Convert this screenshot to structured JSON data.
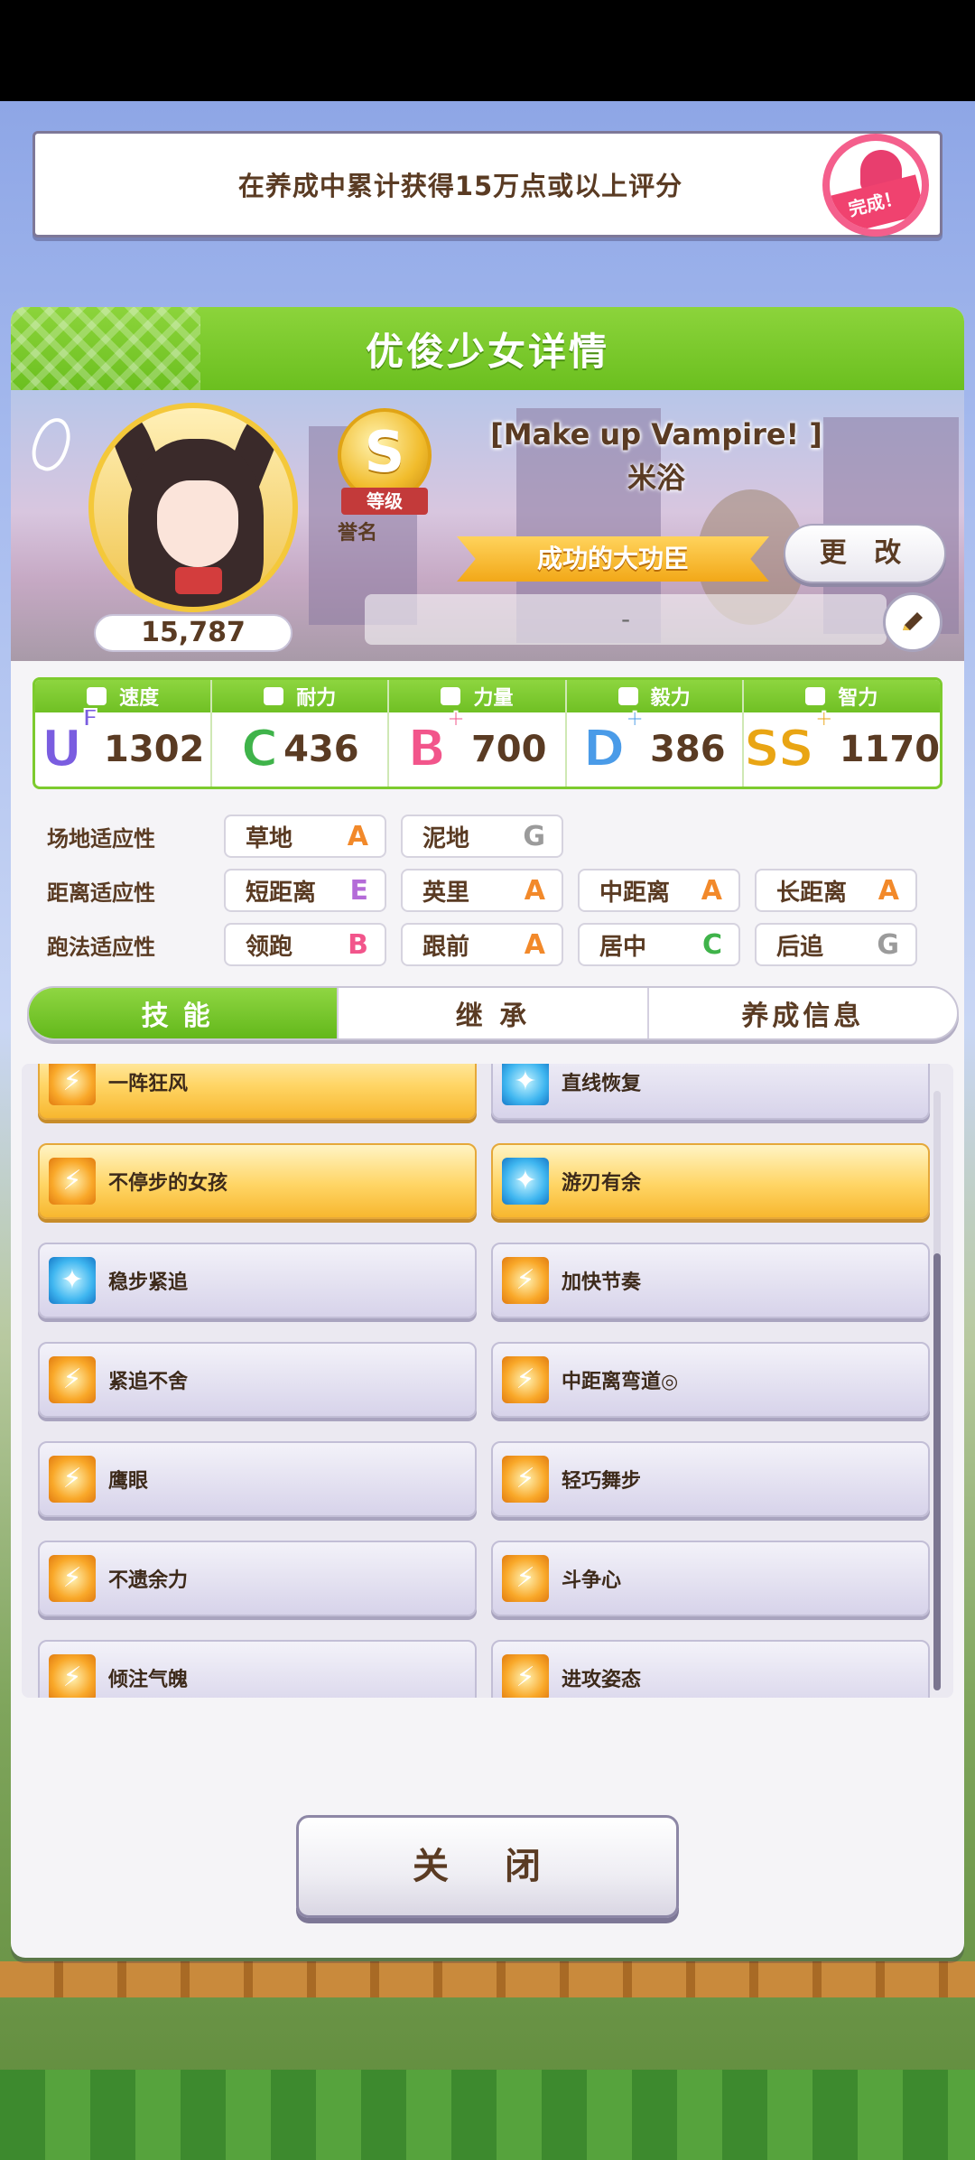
{
  "mission": {
    "text": "在养成中累计获得15万点或以上评分",
    "stamp_label": "完成！"
  },
  "dialog": {
    "title": "优俊少女详情"
  },
  "profile": {
    "score": "15,787",
    "rank_letter": "S",
    "rank_label": "等级",
    "title_label": "誉名",
    "outfit": "[Make up Vampire! ]",
    "name": "米浴",
    "epithet": "成功的大功臣",
    "change_label": "更 改",
    "memo": "-"
  },
  "stats": [
    {
      "label": "速度",
      "grade": "U",
      "grade_sup": "F",
      "value": "1302",
      "color": "#7a5de0"
    },
    {
      "label": "耐力",
      "grade": "C",
      "grade_sup": "",
      "value": "436",
      "color": "#3fb34a"
    },
    {
      "label": "力量",
      "grade": "B",
      "grade_sup": "+",
      "value": "700",
      "color": "#f2558b"
    },
    {
      "label": "毅力",
      "grade": "D",
      "grade_sup": "+",
      "value": "386",
      "color": "#4a9be8"
    },
    {
      "label": "智力",
      "grade": "SS",
      "grade_sup": "+",
      "value": "1170",
      "color": "#e9a514"
    }
  ],
  "aptitudes": {
    "rows": [
      {
        "label": "场地适应性",
        "cells": [
          {
            "name": "草地",
            "grade": "A"
          },
          {
            "name": "泥地",
            "grade": "G"
          }
        ]
      },
      {
        "label": "距离适应性",
        "cells": [
          {
            "name": "短距离",
            "grade": "E"
          },
          {
            "name": "英里",
            "grade": "A"
          },
          {
            "name": "中距离",
            "grade": "A"
          },
          {
            "name": "长距离",
            "grade": "A"
          }
        ]
      },
      {
        "label": "跑法适应性",
        "cells": [
          {
            "name": "领跑",
            "grade": "B"
          },
          {
            "name": "跟前",
            "grade": "A"
          },
          {
            "name": "居中",
            "grade": "C"
          },
          {
            "name": "后追",
            "grade": "G"
          }
        ]
      }
    ]
  },
  "tabs": [
    {
      "label": "技能",
      "active": true
    },
    {
      "label": "继 承",
      "active": false
    },
    {
      "label": "养成信息",
      "active": false
    }
  ],
  "skills": [
    {
      "name": "一阵狂风",
      "style": "gold",
      "icon": "orange"
    },
    {
      "name": "直线恢复",
      "style": "normal",
      "icon": "blue"
    },
    {
      "name": "不停步的女孩",
      "style": "gold",
      "icon": "orange"
    },
    {
      "name": "游刃有余",
      "style": "gold",
      "icon": "blue"
    },
    {
      "name": "稳步紧追",
      "style": "normal",
      "icon": "blue"
    },
    {
      "name": "加快节奏",
      "style": "normal",
      "icon": "orange"
    },
    {
      "name": "紧追不舍",
      "style": "normal",
      "icon": "orange"
    },
    {
      "name": "中距离弯道◎",
      "style": "normal",
      "icon": "orange"
    },
    {
      "name": "鹰眼",
      "style": "normal",
      "icon": "orange"
    },
    {
      "name": "轻巧舞步",
      "style": "normal",
      "icon": "orange"
    },
    {
      "name": "不遗余力",
      "style": "normal",
      "icon": "orange"
    },
    {
      "name": "斗争心",
      "style": "normal",
      "icon": "orange"
    },
    {
      "name": "倾注气魄",
      "style": "normal",
      "icon": "orange"
    },
    {
      "name": "进攻姿态",
      "style": "normal",
      "icon": "orange"
    }
  ],
  "close_label": "关 闭"
}
